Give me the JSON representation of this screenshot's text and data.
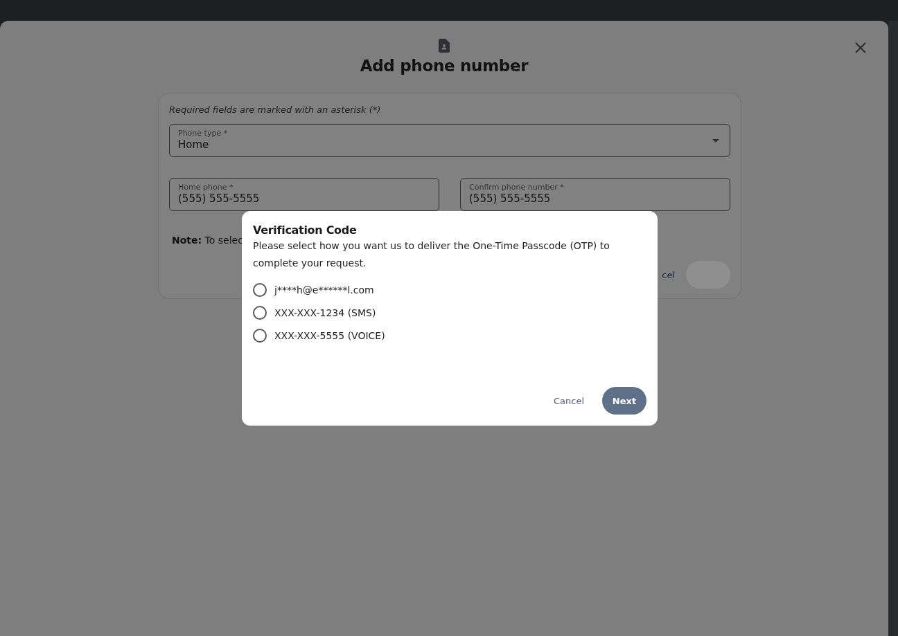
{
  "sheet": {
    "title": "Add phone number"
  },
  "form": {
    "required_note": "Required fields are marked with an asterisk (*)",
    "phone_type": {
      "label": "Phone type *",
      "value": "Home"
    },
    "phone_fields": [
      {
        "label": "Home phone *",
        "value": "(555) 555-5555"
      },
      {
        "label": "Confirm phone number *",
        "value": "(555) 555-5555"
      }
    ],
    "note": "**Note:** To selec",
    "cancel_link": "cel",
    "submit": {
      "disabled": true
    }
  },
  "dialog": {
    "title": "Verification Code",
    "message": "Please select how you want us to deliver the One-Time Passcode (OTP) to complete your request.",
    "options": [
      {
        "label": "j****h@e******l.com",
        "selected": false
      },
      {
        "label": "XXX-XXX-1234 (SMS)",
        "selected": false
      },
      {
        "label": "XXX-XXX-5555 (VOICE)",
        "selected": false
      }
    ],
    "cancel": "Cancel",
    "next": "Next"
  }
}
